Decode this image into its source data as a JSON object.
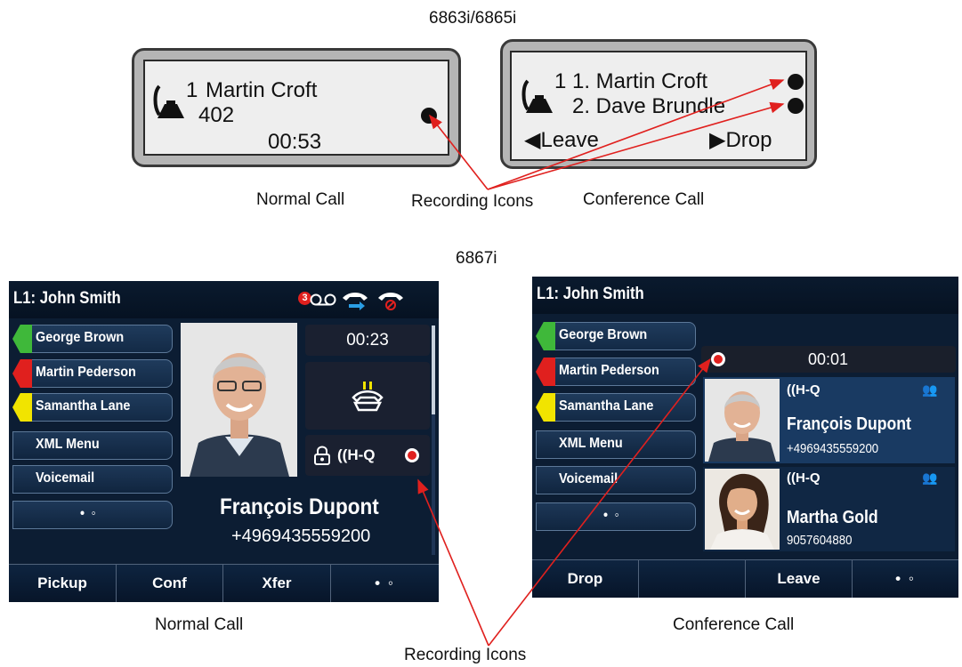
{
  "top_section": {
    "model_label": "6863i/6865i",
    "normal_call": {
      "line_number": "1",
      "name": "Martin Croft",
      "extension": "402",
      "timer": "00:53",
      "caption": "Normal Call"
    },
    "conference_call": {
      "line_number": "1",
      "party1": "1. Martin Croft",
      "party2": "2. Dave Brundle",
      "left_key": "Leave",
      "right_key": "Drop",
      "caption": "Conference Call"
    },
    "annotation": "Recording Icons"
  },
  "bottom_section": {
    "model_label": "6867i",
    "normal_call": {
      "header_title": "L1: John Smith",
      "notification_count": "3",
      "line_keys": [
        {
          "label": "George Brown",
          "status": "green"
        },
        {
          "label": "Martin Pederson",
          "status": "red"
        },
        {
          "label": "Samantha Lane",
          "status": "yellow"
        },
        {
          "label": "XML Menu",
          "status": "none"
        },
        {
          "label": "Voicemail",
          "status": "none"
        },
        {
          "label": "• ◦",
          "status": "none"
        }
      ],
      "timer": "00:23",
      "hiq_label": "((H-Q",
      "caller_name": "François Dupont",
      "caller_number": "+4969435559200",
      "softkeys": [
        "Pickup",
        "Conf",
        "Xfer",
        "• ◦"
      ],
      "caption": "Normal Call"
    },
    "conference_call": {
      "header_title": "L1: John Smith",
      "line_keys": [
        {
          "label": "George Brown",
          "status": "green"
        },
        {
          "label": "Martin Pederson",
          "status": "red"
        },
        {
          "label": "Samantha Lane",
          "status": "yellow"
        },
        {
          "label": "XML Menu",
          "status": "none"
        },
        {
          "label": "Voicemail",
          "status": "none"
        },
        {
          "label": "• ◦",
          "status": "none"
        }
      ],
      "timer": "00:01",
      "participants": [
        {
          "hiq": "((H-Q",
          "name": "François Dupont",
          "number": "+4969435559200"
        },
        {
          "hiq": "((H-Q",
          "name": "Martha Gold",
          "number": "9057604880"
        }
      ],
      "softkeys": [
        "Drop",
        "",
        "Leave",
        "• ◦"
      ],
      "caption": "Conference Call"
    },
    "annotation": "Recording Icons"
  },
  "colors": {
    "annotation_arrow": "#e0201e",
    "screen_bg": "#0c1d33",
    "status_green": "#3fb83a",
    "status_red": "#e0201e",
    "status_yellow": "#f1e400"
  }
}
